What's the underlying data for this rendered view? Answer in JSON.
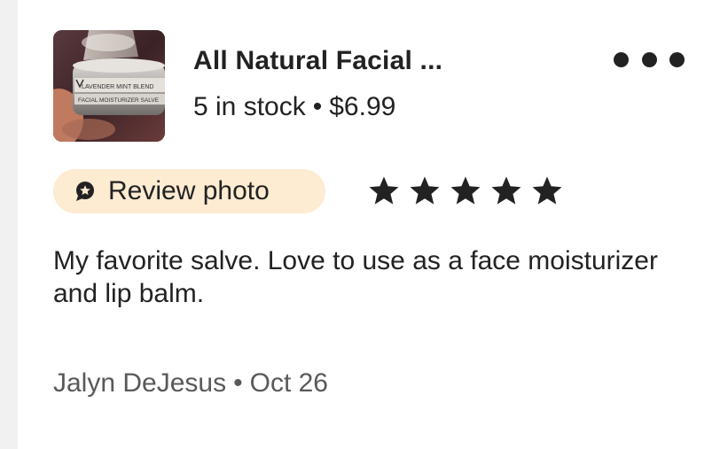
{
  "product": {
    "title": "All Natural Facial ...",
    "stock": "5 in stock",
    "separator": "•",
    "price": "$6.99",
    "thumbnail_label_top": "LAVENDER MINT BLEND",
    "thumbnail_label_bottom": "FACIAL MOISTURIZER SALVE"
  },
  "review": {
    "photo_pill_label": "Review photo",
    "rating": 5,
    "rating_max": 5,
    "text": "My favorite salve. Love to use as a face moisturizer and lip balm.",
    "author": "Jalyn DeJesus",
    "separator": "•",
    "date": "Oct 26"
  },
  "icons": {
    "more": "more-horizontal-icon",
    "photo_badge": "star-badge-icon",
    "rating_star": "star-icon"
  },
  "colors": {
    "pill_background": "#fdebd2",
    "text_primary": "#222222",
    "text_secondary": "#595959",
    "page_gutter": "#f1f1f1"
  }
}
